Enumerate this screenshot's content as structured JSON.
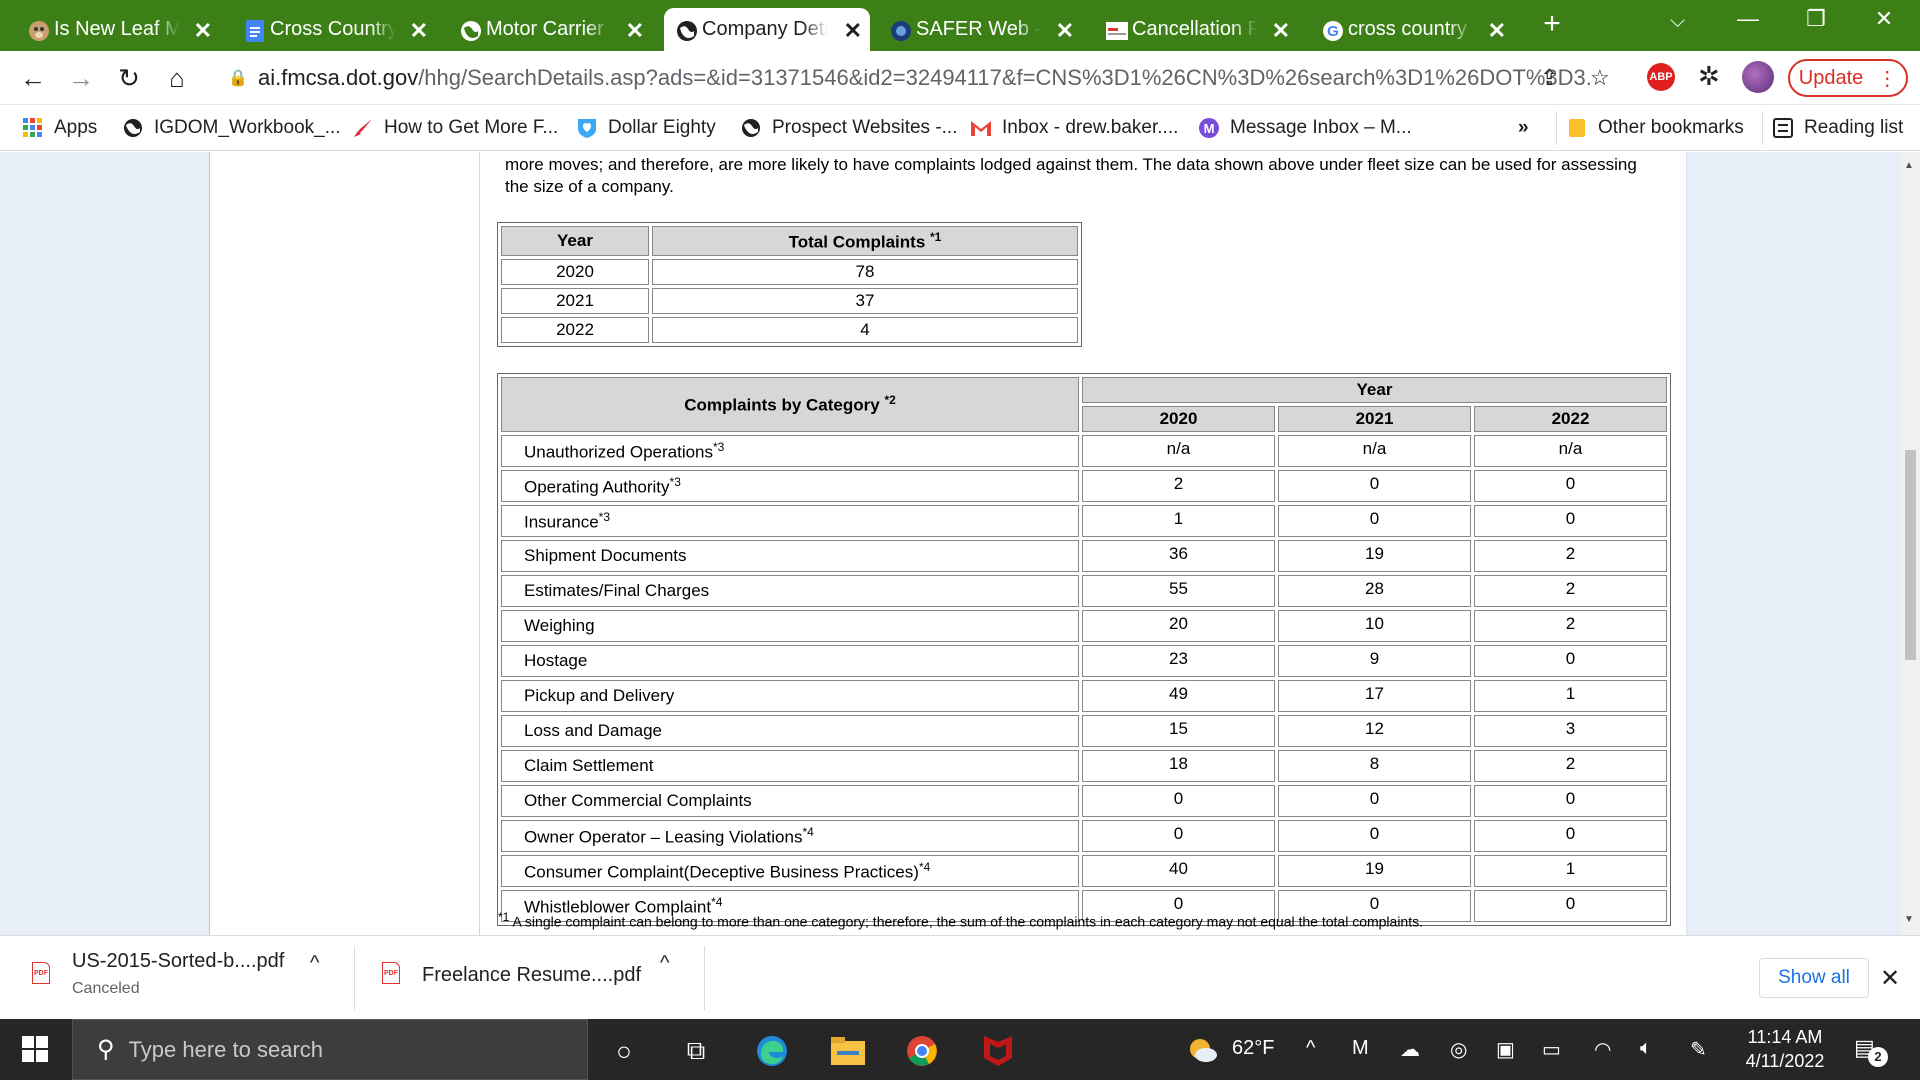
{
  "browser": {
    "tabs": [
      {
        "title": "Is New Leaf Mo",
        "icon": "monkey-icon"
      },
      {
        "title": "Cross Country |",
        "icon": "docs-icon"
      },
      {
        "title": "Motor Carrier D",
        "icon": "globe-icon"
      },
      {
        "title": "Company Deta",
        "icon": "globe-icon",
        "active": true
      },
      {
        "title": "SAFER Web - C",
        "icon": "dot-seal-icon"
      },
      {
        "title": "Cancellation Po",
        "icon": "page-icon"
      },
      {
        "title": "cross country m",
        "icon": "google-icon"
      }
    ],
    "url_host": "ai.fmcsa.dot.gov",
    "url_path": "/hhg/SearchDetails.asp?ads=&id=31371546&id2=32494117&f=CNS%3D1%26CN%3D%26search%3D1%26DOT%3D3...",
    "update_label": "Update"
  },
  "bookmarks": {
    "apps": "Apps",
    "items": [
      "IGDOM_Workbook_...",
      "How to Get More F...",
      "Dollar Eighty",
      "Prospect Websites -...",
      "Inbox - drew.baker....",
      "Message Inbox – M..."
    ],
    "overflow": "»",
    "other": "Other bookmarks",
    "reading_list": "Reading list"
  },
  "page": {
    "intro": "more moves; and therefore, are more likely to have complaints lodged against them. The data shown above under fleet size can be used for assessing the size of a company.",
    "totals": {
      "col_year": "Year",
      "col_total": "Total Complaints",
      "col_total_note": "*1",
      "rows": [
        {
          "year": "2020",
          "total": "78"
        },
        {
          "year": "2021",
          "total": "37"
        },
        {
          "year": "2022",
          "total": "4"
        }
      ]
    },
    "category": {
      "header": "Complaints by Category",
      "header_note": "*2",
      "year_header": "Year",
      "years": [
        "2020",
        "2021",
        "2022"
      ],
      "rows": [
        {
          "label": "Unauthorized Operations",
          "note": "*3",
          "v": [
            "n/a",
            "n/a",
            "n/a"
          ]
        },
        {
          "label": "Operating Authority",
          "note": "*3",
          "v": [
            "2",
            "0",
            "0"
          ]
        },
        {
          "label": "Insurance",
          "note": "*3",
          "v": [
            "1",
            "0",
            "0"
          ]
        },
        {
          "label": "Shipment Documents",
          "note": "",
          "v": [
            "36",
            "19",
            "2"
          ]
        },
        {
          "label": "Estimates/Final Charges",
          "note": "",
          "v": [
            "55",
            "28",
            "2"
          ]
        },
        {
          "label": "Weighing",
          "note": "",
          "v": [
            "20",
            "10",
            "2"
          ]
        },
        {
          "label": "Hostage",
          "note": "",
          "v": [
            "23",
            "9",
            "0"
          ]
        },
        {
          "label": "Pickup and Delivery",
          "note": "",
          "v": [
            "49",
            "17",
            "1"
          ]
        },
        {
          "label": "Loss and Damage",
          "note": "",
          "v": [
            "15",
            "12",
            "3"
          ]
        },
        {
          "label": "Claim Settlement",
          "note": "",
          "v": [
            "18",
            "8",
            "2"
          ]
        },
        {
          "label": "Other Commercial Complaints",
          "note": "",
          "v": [
            "0",
            "0",
            "0"
          ]
        },
        {
          "label": "Owner Operator – Leasing Violations",
          "note": "*4",
          "v": [
            "0",
            "0",
            "0"
          ]
        },
        {
          "label": "Consumer Complaint(Deceptive Business Practices)",
          "note": "*4",
          "v": [
            "40",
            "19",
            "1"
          ]
        },
        {
          "label": "Whistleblower Complaint",
          "note": "*4",
          "v": [
            "0",
            "0",
            "0"
          ]
        }
      ]
    },
    "footnote_mark": "*1",
    "footnote": "A single complaint can belong to more than one category; therefore, the sum of the complaints in each category may not equal the total complaints."
  },
  "downloads": {
    "items": [
      {
        "name": "US-2015-Sorted-b....pdf",
        "status": "Canceled"
      },
      {
        "name": "Freelance Resume....pdf",
        "status": ""
      }
    ],
    "show_all": "Show all"
  },
  "taskbar": {
    "search_placeholder": "Type here to search",
    "weather": "62°F",
    "time": "11:14 AM",
    "date": "4/11/2022",
    "notifications": "2"
  }
}
